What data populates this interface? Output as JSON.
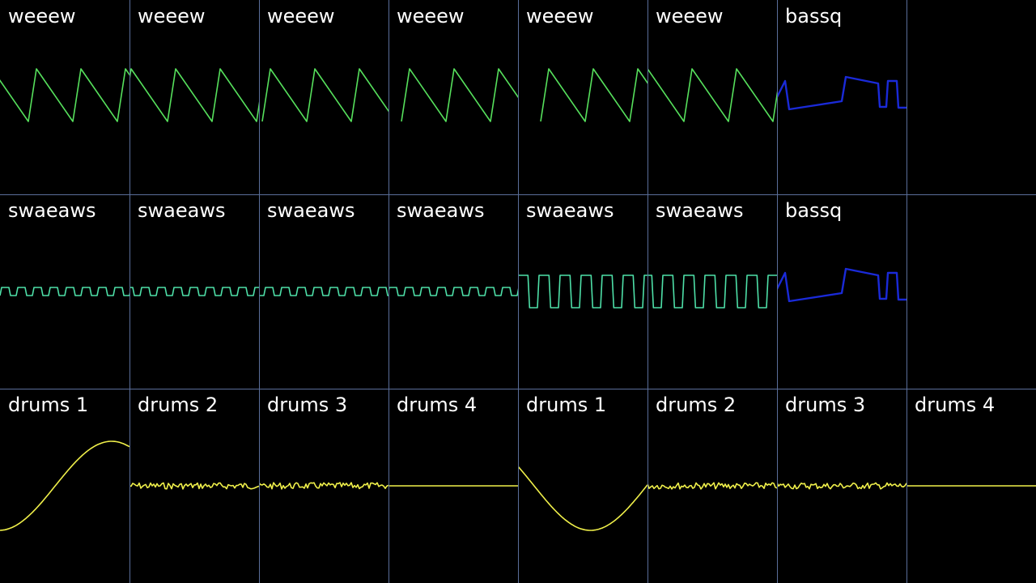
{
  "colors": {
    "background": "#000000",
    "grid": "#5a6e9a",
    "label": "#ffffff",
    "saw": "#56e05c",
    "pulse": "#4ee0a8",
    "bass": "#1a2ad8",
    "drums": "#f0f04a"
  },
  "rows": [
    {
      "cells": [
        {
          "label": "weeew",
          "wave": "saw"
        },
        {
          "label": "weeew",
          "wave": "saw"
        },
        {
          "label": "weeew",
          "wave": "saw"
        },
        {
          "label": "weeew",
          "wave": "saw"
        },
        {
          "label": "weeew",
          "wave": "saw"
        },
        {
          "label": "weeew",
          "wave": "saw"
        },
        {
          "label": "bassq",
          "wave": "bass"
        },
        {
          "label": "",
          "wave": "none"
        }
      ]
    },
    {
      "cells": [
        {
          "label": "swaeaws",
          "wave": "pulse-small"
        },
        {
          "label": "swaeaws",
          "wave": "pulse-small"
        },
        {
          "label": "swaeaws",
          "wave": "pulse-small"
        },
        {
          "label": "swaeaws",
          "wave": "pulse-small"
        },
        {
          "label": "swaeaws",
          "wave": "pulse-large"
        },
        {
          "label": "swaeaws",
          "wave": "pulse-large"
        },
        {
          "label": "bassq",
          "wave": "bass"
        },
        {
          "label": "",
          "wave": "none"
        }
      ]
    },
    {
      "cells": [
        {
          "label": "drums 1",
          "wave": "kick"
        },
        {
          "label": "drums 2",
          "wave": "noise"
        },
        {
          "label": "drums 3",
          "wave": "noise"
        },
        {
          "label": "drums 4",
          "wave": "flat"
        },
        {
          "label": "drums 1",
          "wave": "kick"
        },
        {
          "label": "drums 2",
          "wave": "noise"
        },
        {
          "label": "drums 3",
          "wave": "noise"
        },
        {
          "label": "drums 4",
          "wave": "flat"
        }
      ]
    }
  ]
}
